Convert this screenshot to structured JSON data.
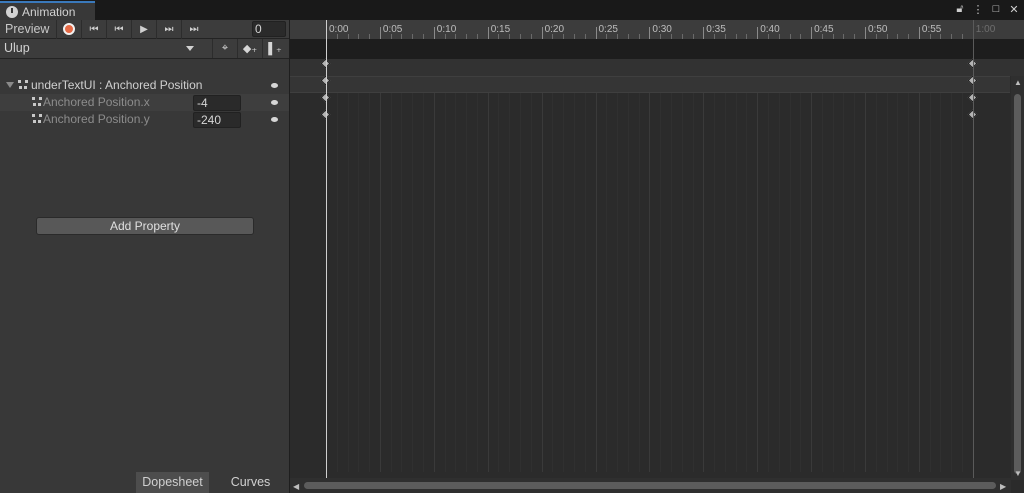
{
  "window": {
    "tab_label": "Animation",
    "tab_icon": "clock-icon"
  },
  "toolbar": {
    "preview_label": "Preview",
    "frame_value": "0",
    "clip_name": "Ulup"
  },
  "properties": {
    "group_label": "underTextUI : Anchored Position",
    "items": [
      {
        "label": "Anchored Position.x",
        "value": "-4"
      },
      {
        "label": "Anchored Position.y",
        "value": "-240"
      }
    ],
    "add_label": "Add Property"
  },
  "bottom_tabs": {
    "dopesheet": "Dopesheet",
    "curves": "Curves"
  },
  "timeline": {
    "labels": [
      "0:00",
      "0:05",
      "0:10",
      "0:15",
      "0:20",
      "0:25",
      "0:30",
      "0:35",
      "0:40",
      "0:45",
      "0:50",
      "0:55",
      "1:00"
    ],
    "current_time": "0:00",
    "clip_end": "1:00",
    "keyframe_times": [
      "0:00",
      "1:00"
    ]
  }
}
